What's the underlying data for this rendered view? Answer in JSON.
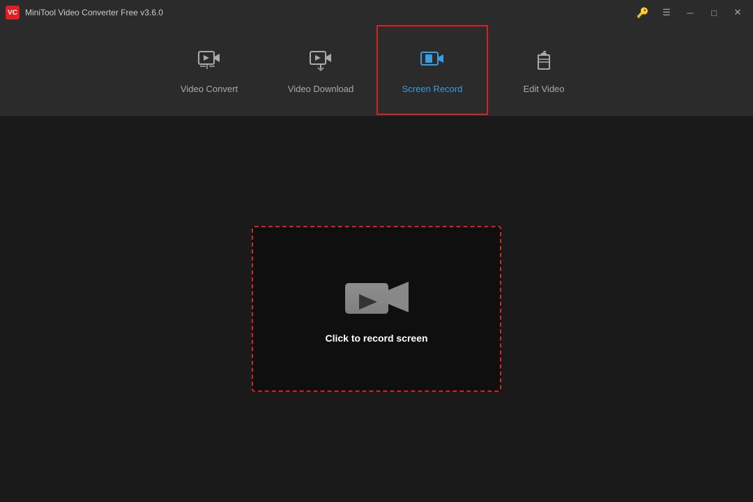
{
  "app": {
    "title": "MiniTool Video Converter Free v3.6.0",
    "logo_text": "VC"
  },
  "titlebar": {
    "key_icon": "🔑",
    "menu_icon": "☰",
    "minimize_icon": "─",
    "maximize_icon": "□",
    "close_icon": "✕"
  },
  "nav": {
    "tabs": [
      {
        "id": "video-convert",
        "label": "Video Convert",
        "active": false
      },
      {
        "id": "video-download",
        "label": "Video Download",
        "active": false
      },
      {
        "id": "screen-record",
        "label": "Screen Record",
        "active": true
      },
      {
        "id": "edit-video",
        "label": "Edit Video",
        "active": false
      }
    ]
  },
  "record_area": {
    "prompt_text": "Click to record screen"
  }
}
